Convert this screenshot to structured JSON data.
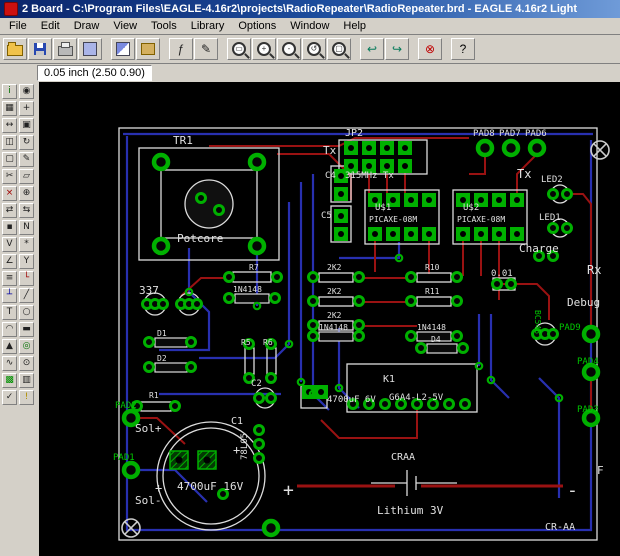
{
  "window": {
    "title": "2 Board - C:\\Program Files\\EAGLE-4.16r2\\projects\\RadioRepeater\\RadioRepeater.brd - EAGLE 4.16r2 Light"
  },
  "menu": {
    "items": [
      "File",
      "Edit",
      "Draw",
      "View",
      "Tools",
      "Library",
      "Options",
      "Window",
      "Help"
    ]
  },
  "toolbar": {
    "buttons": [
      {
        "id": "open",
        "css": "ic-open"
      },
      {
        "id": "save",
        "css": "ic-save"
      },
      {
        "id": "print",
        "css": "ic-print"
      },
      {
        "id": "cam-processor",
        "css": "ic-cam"
      },
      {
        "sep": true
      },
      {
        "id": "board-schematic-toggle",
        "css": "ic-swap"
      },
      {
        "id": "library-use",
        "css": "ic-lib"
      },
      {
        "sep": true
      },
      {
        "id": "run-script",
        "glyph": "ƒ"
      },
      {
        "id": "edit-text",
        "glyph": "✎"
      },
      {
        "sep": true
      },
      {
        "id": "zoom-fit",
        "css": "mag",
        "glyph": "▭"
      },
      {
        "id": "zoom-in",
        "css": "mag",
        "glyph": "+"
      },
      {
        "id": "zoom-out",
        "css": "mag",
        "glyph": "-"
      },
      {
        "id": "zoom-redraw",
        "css": "mag",
        "glyph": "↺"
      },
      {
        "id": "zoom-select",
        "css": "mag",
        "glyph": "▢"
      },
      {
        "sep": true
      },
      {
        "id": "undo",
        "glyph": "↩",
        "color": "#067a5a"
      },
      {
        "id": "redo",
        "glyph": "↪",
        "color": "#067a5a"
      },
      {
        "sep": true
      },
      {
        "id": "stop",
        "glyph": "⊗",
        "color": "#c00000"
      },
      {
        "sep": true
      },
      {
        "id": "help",
        "glyph": "?",
        "color": "#000000"
      }
    ]
  },
  "statusbar": {
    "coords": "0.05 inch (2.50 0.90)",
    "command_value": ""
  },
  "tools": {
    "items": [
      {
        "id": "info",
        "glyph": "i",
        "color": "#007000"
      },
      {
        "id": "show",
        "glyph": "◉"
      },
      {
        "id": "display",
        "glyph": "▦"
      },
      {
        "id": "mark",
        "glyph": "+"
      },
      {
        "id": "move",
        "glyph": "↔"
      },
      {
        "id": "copy",
        "glyph": "▣"
      },
      {
        "id": "mirror",
        "glyph": "◫"
      },
      {
        "id": "rotate",
        "glyph": "↻"
      },
      {
        "id": "group",
        "glyph": "▢"
      },
      {
        "id": "change",
        "glyph": "✎"
      },
      {
        "id": "cut",
        "glyph": "✂"
      },
      {
        "id": "paste",
        "glyph": "▱"
      },
      {
        "id": "delete",
        "glyph": "×",
        "color": "#a00000"
      },
      {
        "id": "add",
        "glyph": "⊕"
      },
      {
        "id": "pinswap",
        "glyph": "⇄"
      },
      {
        "id": "replace",
        "glyph": "⇆"
      },
      {
        "id": "lock",
        "glyph": "▪"
      },
      {
        "id": "name",
        "glyph": "N"
      },
      {
        "id": "value",
        "glyph": "V"
      },
      {
        "id": "smash",
        "glyph": "*"
      },
      {
        "id": "miter",
        "glyph": "∠"
      },
      {
        "id": "split",
        "glyph": "Y"
      },
      {
        "id": "optimize",
        "glyph": "≡"
      },
      {
        "id": "route",
        "glyph": "└",
        "color": "#a00000"
      },
      {
        "id": "ripup",
        "glyph": "┴",
        "color": "#0000a0"
      },
      {
        "id": "wire",
        "glyph": "╱"
      },
      {
        "id": "text",
        "glyph": "T"
      },
      {
        "id": "circle",
        "glyph": "○"
      },
      {
        "id": "arc",
        "glyph": "◠"
      },
      {
        "id": "rect",
        "glyph": "▬"
      },
      {
        "id": "polygon",
        "glyph": "▲"
      },
      {
        "id": "via",
        "glyph": "◎",
        "color": "#007000"
      },
      {
        "id": "signal",
        "glyph": "∿"
      },
      {
        "id": "hole",
        "glyph": "⊙"
      },
      {
        "id": "ratsnest",
        "glyph": "▩",
        "color": "#009000"
      },
      {
        "id": "auto",
        "glyph": "▥"
      },
      {
        "id": "drc",
        "glyph": "✓"
      },
      {
        "id": "errors",
        "glyph": "!",
        "color": "#b09000"
      }
    ]
  },
  "colors": {
    "titlebar": "#0a246a",
    "ui_gray": "#d4d0c8",
    "canvas_bg": "#000000",
    "silkscreen": "#dcdcdc",
    "copper_top": "#9a1212",
    "copper_bottom": "#2830b0",
    "pad_green": "#00b000",
    "label_green": "#00c800"
  },
  "pcb": {
    "labels": {
      "tr1": "TR1",
      "potcore": "Potcore",
      "jp2": "JP2",
      "tx_top": "Tx",
      "c4": "C4",
      "c4_value": "315MHz Tx",
      "c5": "C5",
      "u1": "U$1",
      "u1_value": "PICAXE-08M",
      "u2": "U$2",
      "u2_value": "PICAXE-08M",
      "tx_right": "Tx",
      "pad8": "PAD8",
      "pad7": "PAD7",
      "pad6": "PAD6",
      "led2": "LED2",
      "led1": "LED1",
      "charge": "Charge",
      "rx": "Rx",
      "debug": "Debug",
      "pad9": "PAD9",
      "pad4": "PAD4",
      "pad3": "PAD3",
      "q_right": "BC548",
      "r337": "337",
      "r7": "R7",
      "d_r7": "1N4148",
      "rv1": "2K2",
      "rv2": "2K2",
      "rv3": "2K2",
      "r10": "R10",
      "r11": "R11",
      "d_mid": "1N4148",
      "d_right": "1N4148",
      "c001": "0.01",
      "d1": "D1",
      "d2": "D2",
      "d4": "D4",
      "r5": "R5",
      "r6": "R6",
      "c2": "C2",
      "k1": "K1",
      "k1_value": "G6A4-L2-5V",
      "c3_value": "4700uF 6V",
      "c1": "C1",
      "c1_value": "4700uF 16V",
      "reg78": "78L05",
      "r1": "R1",
      "pad2": "PAD2",
      "solp": "Sol+",
      "pad1": "PAD1",
      "soln": "Sol-",
      "craa": "CRAA",
      "lithium": "Lithium 3V",
      "bat_plus": "+",
      "bat_minus": "-",
      "cr_aa": "CR-AA",
      "f": "F",
      "cap_plus_a": "+",
      "cap_plus_b": "+"
    }
  }
}
